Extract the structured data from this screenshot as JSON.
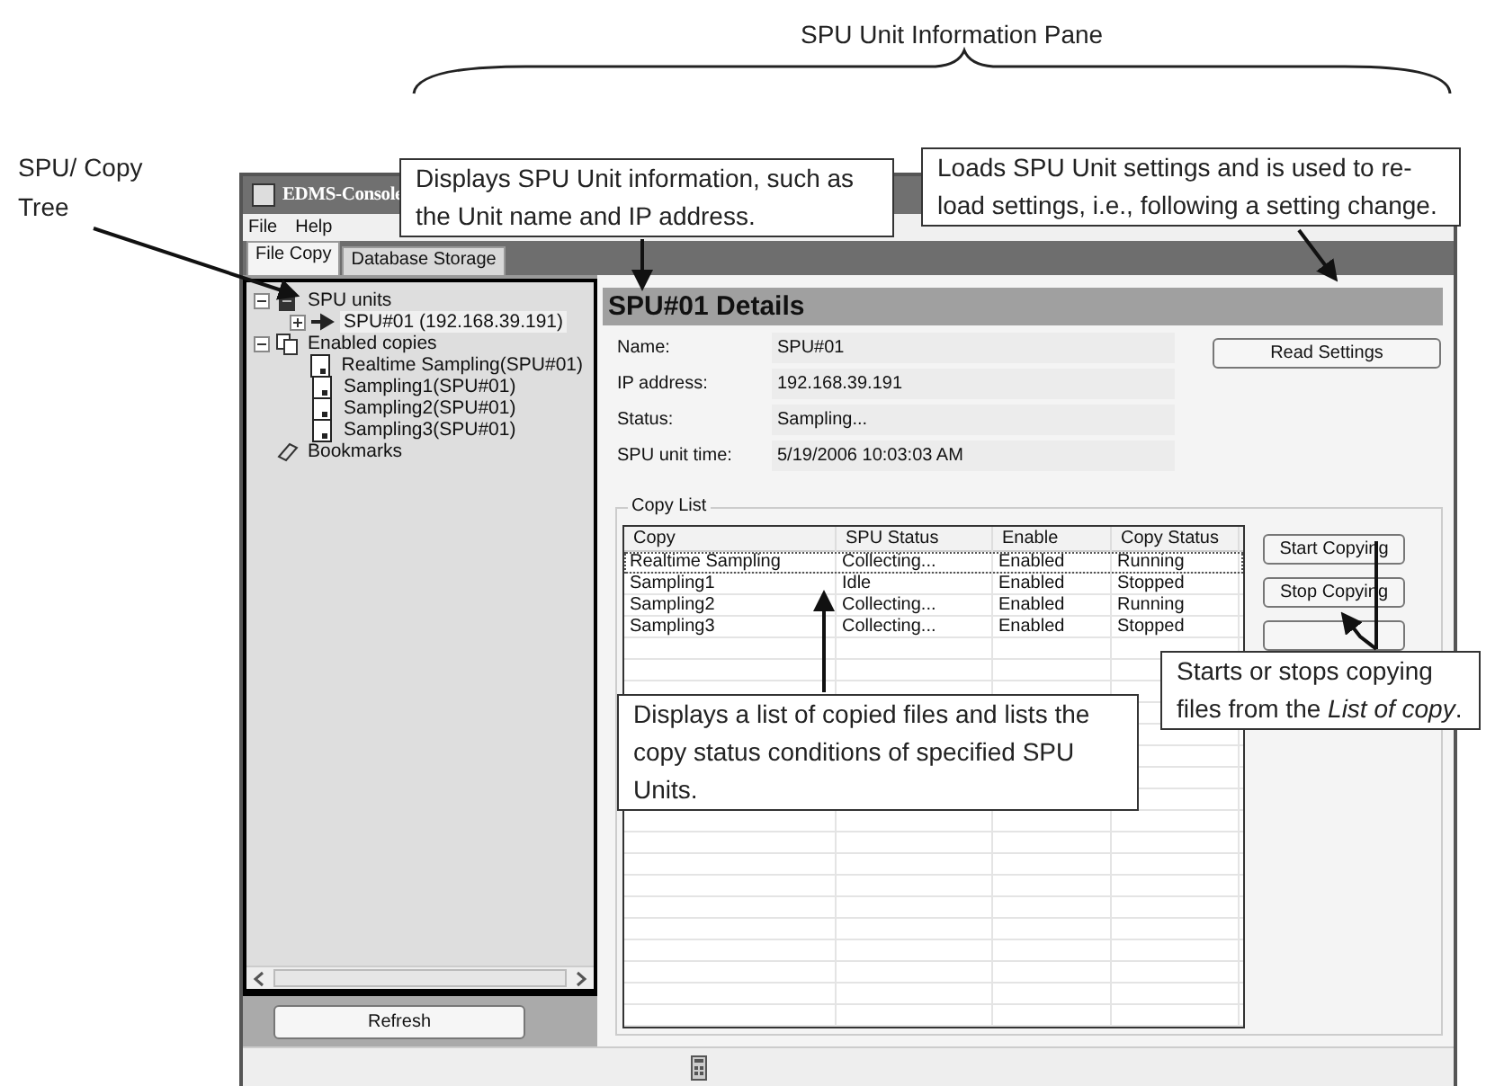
{
  "pane_label": "SPU Unit Information Pane",
  "side_label": "SPU/ Copy Tree",
  "callouts": [
    {
      "text": "Displays SPU Unit information, such as the Unit name and IP address."
    },
    {
      "text": "Loads SPU Unit settings and is used to re-load settings, i.e., following a setting change."
    },
    {
      "text": "Displays a list of copied files and lists the copy status conditions of specified SPU Units."
    },
    {
      "text": "Starts or stops copying files from the *List of copy*."
    }
  ],
  "window": {
    "title": "EDMS-Console",
    "menu": [
      {
        "label": "File"
      },
      {
        "label": "Help"
      }
    ],
    "tabs": [
      {
        "label": "File Copy",
        "selected": true
      },
      {
        "label": "Database Storage",
        "selected": false
      }
    ],
    "tree": [
      {
        "label": "SPU units",
        "kind": "server",
        "expanded": true,
        "selected": false,
        "children": [
          {
            "label": "SPU#01 (192.168.39.191)",
            "kind": "arrow",
            "expanded": false,
            "selected": true
          }
        ]
      },
      {
        "label": "Enabled copies",
        "kind": "copies",
        "expanded": true,
        "selected": false,
        "children": [
          {
            "label": "Realtime Sampling(SPU#01)",
            "kind": "document",
            "selected": false
          },
          {
            "label": "Sampling1(SPU#01)",
            "kind": "document",
            "selected": false
          },
          {
            "label": "Sampling2(SPU#01)",
            "kind": "document",
            "selected": false
          },
          {
            "label": "Sampling3(SPU#01)",
            "kind": "document",
            "selected": false
          }
        ]
      },
      {
        "label": "Bookmarks",
        "kind": "bookmark",
        "selected": false
      }
    ],
    "refresh_button": {
      "label": "Refresh"
    },
    "details": {
      "title": "SPU#01 Details",
      "fields": [
        {
          "label": "Name:",
          "value": "SPU#01"
        },
        {
          "label": "IP address:",
          "value": "192.168.39.191"
        },
        {
          "label": "Status:",
          "value": "Sampling..."
        },
        {
          "label": "SPU unit time:",
          "value": "5/19/2006 10:03:03 AM"
        }
      ],
      "read_button": {
        "label": "Read Settings"
      },
      "copy_list": {
        "title": "Copy List",
        "columns": [
          "Copy",
          "SPU Status",
          "Enable",
          "Copy Status"
        ],
        "rows": [
          {
            "cells": [
              "Realtime Sampling",
              "Collecting...",
              "Enabled",
              "Running"
            ],
            "focused": true
          },
          {
            "cells": [
              "Sampling1",
              "Idle",
              "Enabled",
              "Stopped"
            ]
          },
          {
            "cells": [
              "Sampling2",
              "Collecting...",
              "Enabled",
              "Running"
            ]
          },
          {
            "cells": [
              "Sampling3",
              "Collecting...",
              "Enabled",
              "Stopped"
            ]
          }
        ]
      },
      "buttons": [
        {
          "label": "Start Copying"
        },
        {
          "label": "Stop Copying"
        }
      ]
    }
  }
}
